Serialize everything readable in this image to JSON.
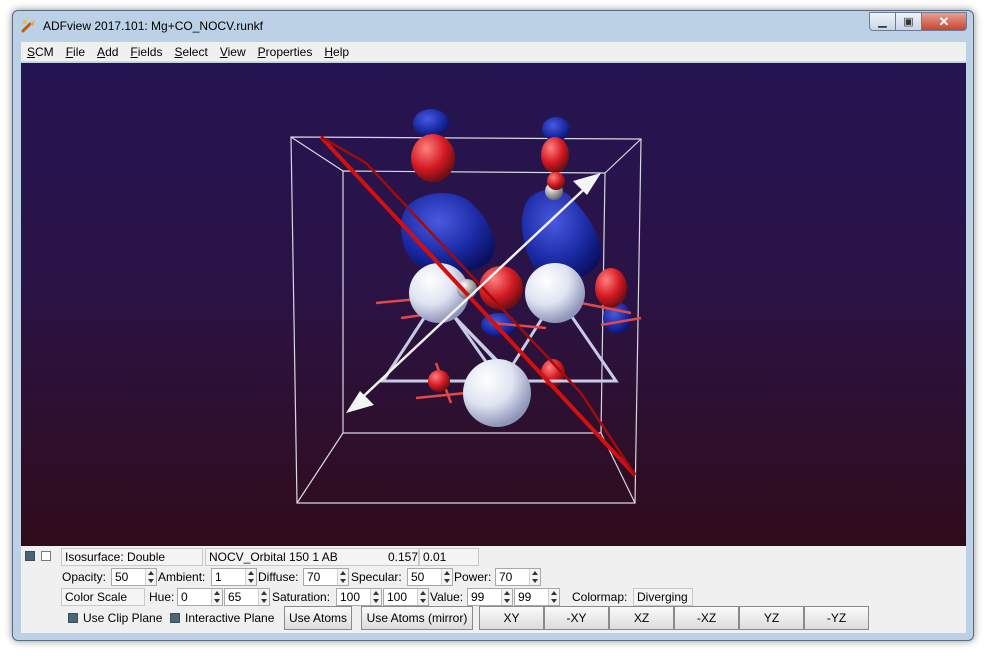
{
  "window": {
    "title": "ADFview 2017.101: Mg+CO_NOCV.runkf",
    "controls": {
      "minimize": "▁",
      "maximize": "▣",
      "close": "✕"
    }
  },
  "menu": [
    {
      "mnemonic": "S",
      "rest": "CM"
    },
    {
      "mnemonic": "F",
      "rest": "ile"
    },
    {
      "mnemonic": "A",
      "rest": "dd"
    },
    {
      "mnemonic": "F",
      "rest": "ields"
    },
    {
      "mnemonic": "S",
      "rest": "elect"
    },
    {
      "mnemonic": "V",
      "rest": "iew"
    },
    {
      "mnemonic": "P",
      "rest": "roperties"
    },
    {
      "mnemonic": "H",
      "rest": "elp"
    }
  ],
  "viewport": {
    "background_top": "#251452",
    "background_bottom": "#300c1a",
    "positive_lobe_color": "#1c2ba6",
    "negative_lobe_color": "#c8141e",
    "atom_color": "#dfe4f2"
  },
  "controls": {
    "row1": {
      "isosurface": "Isosurface: Double",
      "field": "NOCV_Orbital 150 1 AB",
      "value1": "0.157",
      "value2": "0.01"
    },
    "row2": {
      "opacity_label": "Opacity:",
      "opacity": "50",
      "ambient_label": "Ambient:",
      "ambient": "1",
      "diffuse_label": "Diffuse:",
      "diffuse": "70",
      "specular_label": "Specular:",
      "specular": "50",
      "power_label": "Power:",
      "power": "70"
    },
    "row3": {
      "color_scale": "Color Scale",
      "hue_label": "Hue:",
      "hue_min": "0",
      "hue_max": "65",
      "saturation_label": "Saturation:",
      "sat_min": "100",
      "sat_max": "100",
      "value_label": "Value:",
      "val_min": "99",
      "val_max": "99",
      "colormap_label": "Colormap:",
      "colormap": "Diverging"
    },
    "row4": {
      "use_clip_plane": "Use Clip Plane",
      "interactive_plane": "Interactive Plane",
      "use_atoms": "Use Atoms",
      "use_atoms_mirror": "Use Atoms (mirror)",
      "views": [
        "XY",
        "-XY",
        "XZ",
        "-XZ",
        "YZ",
        "-YZ"
      ]
    }
  }
}
